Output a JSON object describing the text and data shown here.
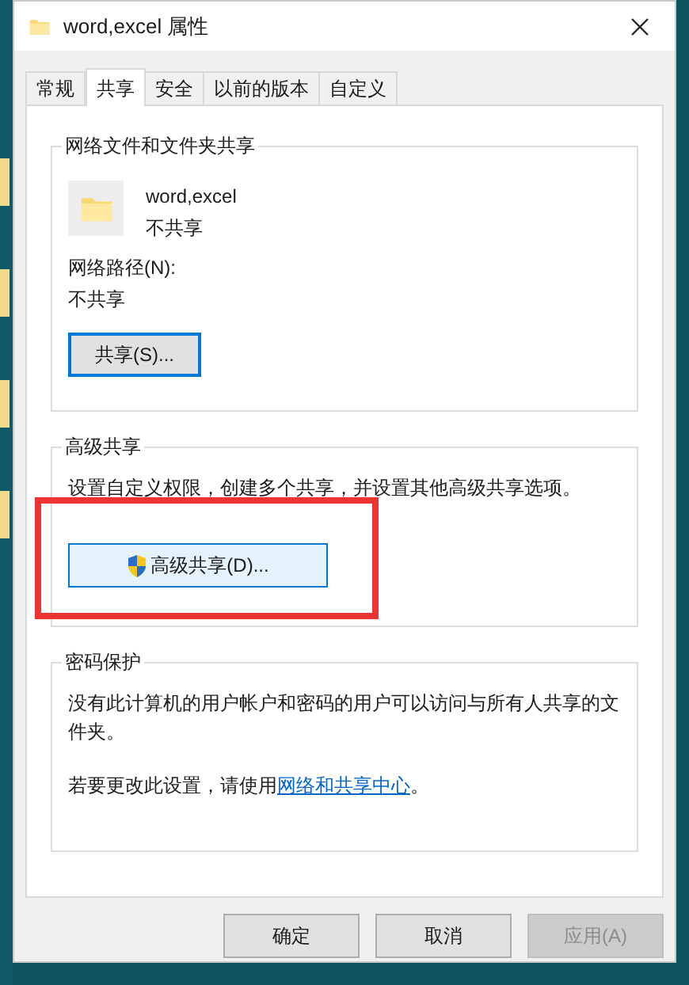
{
  "window": {
    "title": "word,excel 属性"
  },
  "tabs": [
    {
      "label": "常规",
      "selected": false
    },
    {
      "label": "共享",
      "selected": true
    },
    {
      "label": "安全",
      "selected": false
    },
    {
      "label": "以前的版本",
      "selected": false
    },
    {
      "label": "自定义",
      "selected": false
    }
  ],
  "network_sharing": {
    "title": "网络文件和文件夹共享",
    "item_name": "word,excel",
    "item_status": "不共享",
    "path_label": "网络路径(N):",
    "path_value": "不共享",
    "button": "共享(S)...",
    "button_focused": true
  },
  "advanced_sharing": {
    "title": "高级共享",
    "description": "设置自定义权限，创建多个共享，并设置其他高级共享选项。",
    "button": "高级共享(D)...",
    "highlighted": true
  },
  "password_protection": {
    "title": "密码保护",
    "text": "没有此计算机的用户帐户和密码的用户可以访问与所有人共享的文件夹。",
    "change_prefix": "若要更改此设置，请使用",
    "link": "网络和共享中心",
    "change_suffix": "。"
  },
  "buttons": [
    {
      "label": "确定",
      "disabled": false
    },
    {
      "label": "取消",
      "disabled": false
    },
    {
      "label": "应用(A)",
      "disabled": true
    }
  ]
}
